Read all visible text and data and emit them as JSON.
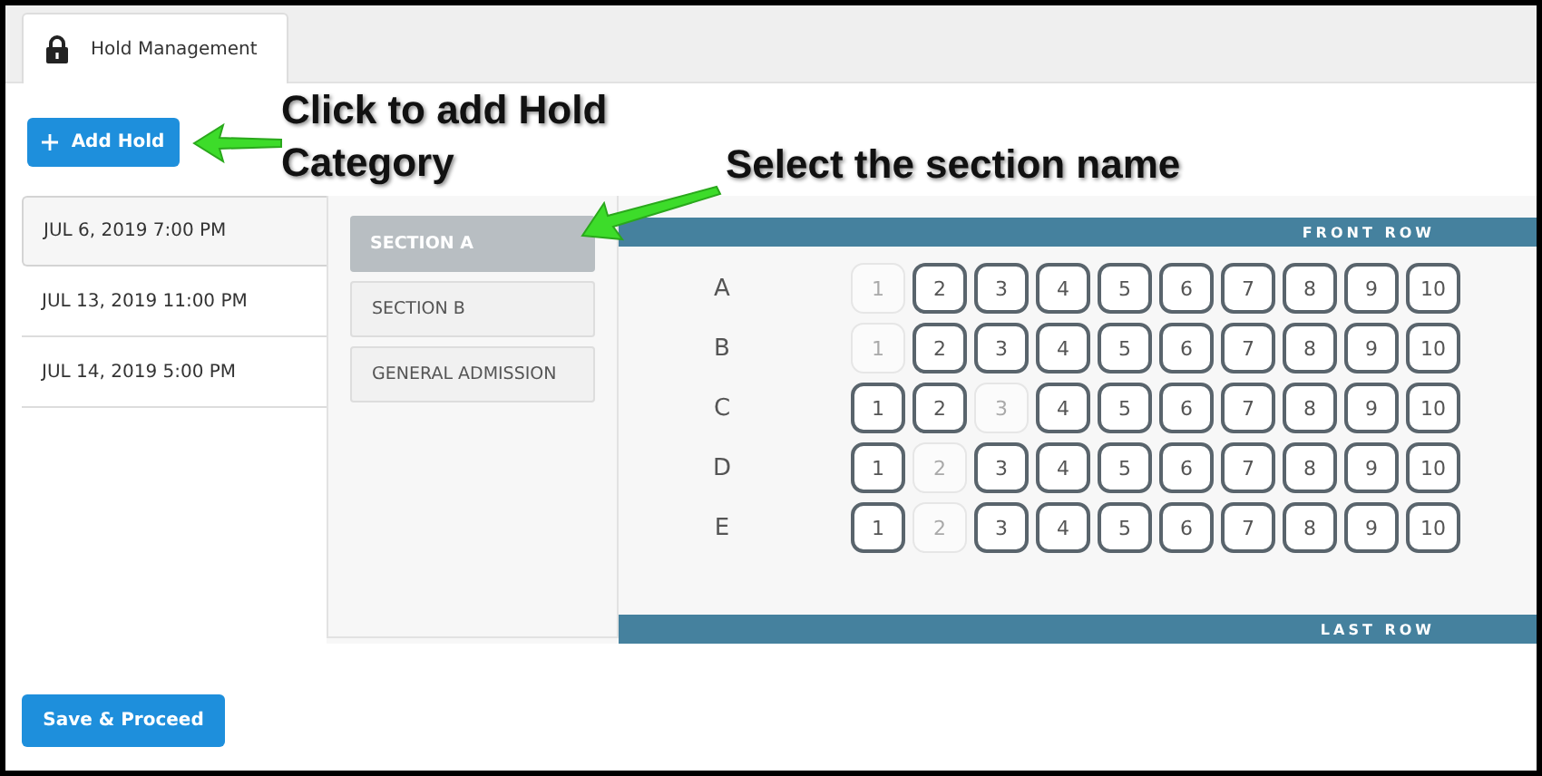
{
  "tab": {
    "label": "Hold Management",
    "selected": true
  },
  "add_button": {
    "label": "Add Hold"
  },
  "events": [
    {
      "label": "JUL 6, 2019 7:00 PM",
      "selected": true
    },
    {
      "label": "JUL 13, 2019 11:00 PM",
      "selected": false
    },
    {
      "label": "JUL 14, 2019 5:00 PM",
      "selected": false
    }
  ],
  "sections": [
    {
      "label": "SECTION A",
      "selected": true
    },
    {
      "label": "SECTION B",
      "selected": false
    },
    {
      "label": "GENERAL ADMISSION",
      "selected": false
    }
  ],
  "seat_map": {
    "front_label": "FRONT ROW",
    "last_label": "LAST ROW",
    "rows": [
      {
        "label": "A",
        "seats": [
          {
            "number": "1",
            "available": false
          },
          {
            "number": "2",
            "available": true
          },
          {
            "number": "3",
            "available": true
          },
          {
            "number": "4",
            "available": true
          },
          {
            "number": "5",
            "available": true
          },
          {
            "number": "6",
            "available": true
          },
          {
            "number": "7",
            "available": true
          },
          {
            "number": "8",
            "available": true
          },
          {
            "number": "9",
            "available": true
          },
          {
            "number": "10",
            "available": true
          }
        ]
      },
      {
        "label": "B",
        "seats": [
          {
            "number": "1",
            "available": false
          },
          {
            "number": "2",
            "available": true
          },
          {
            "number": "3",
            "available": true
          },
          {
            "number": "4",
            "available": true
          },
          {
            "number": "5",
            "available": true
          },
          {
            "number": "6",
            "available": true
          },
          {
            "number": "7",
            "available": true
          },
          {
            "number": "8",
            "available": true
          },
          {
            "number": "9",
            "available": true
          },
          {
            "number": "10",
            "available": true
          }
        ]
      },
      {
        "label": "C",
        "seats": [
          {
            "number": "1",
            "available": true
          },
          {
            "number": "2",
            "available": true
          },
          {
            "number": "3",
            "available": false
          },
          {
            "number": "4",
            "available": true
          },
          {
            "number": "5",
            "available": true
          },
          {
            "number": "6",
            "available": true
          },
          {
            "number": "7",
            "available": true
          },
          {
            "number": "8",
            "available": true
          },
          {
            "number": "9",
            "available": true
          },
          {
            "number": "10",
            "available": true
          }
        ]
      },
      {
        "label": "D",
        "seats": [
          {
            "number": "1",
            "available": true
          },
          {
            "number": "2",
            "available": false
          },
          {
            "number": "3",
            "available": true
          },
          {
            "number": "4",
            "available": true
          },
          {
            "number": "5",
            "available": true
          },
          {
            "number": "6",
            "available": true
          },
          {
            "number": "7",
            "available": true
          },
          {
            "number": "8",
            "available": true
          },
          {
            "number": "9",
            "available": true
          },
          {
            "number": "10",
            "available": true
          }
        ]
      },
      {
        "label": "E",
        "seats": [
          {
            "number": "1",
            "available": true
          },
          {
            "number": "2",
            "available": false
          },
          {
            "number": "3",
            "available": true
          },
          {
            "number": "4",
            "available": true
          },
          {
            "number": "5",
            "available": true
          },
          {
            "number": "6",
            "available": true
          },
          {
            "number": "7",
            "available": true
          },
          {
            "number": "8",
            "available": true
          },
          {
            "number": "9",
            "available": true
          },
          {
            "number": "10",
            "available": true
          }
        ]
      }
    ]
  },
  "save_button": {
    "label": "Save & Proceed"
  },
  "annotations": [
    {
      "text": "Click to add Hold Category"
    },
    {
      "text": "Select the section name"
    }
  ]
}
